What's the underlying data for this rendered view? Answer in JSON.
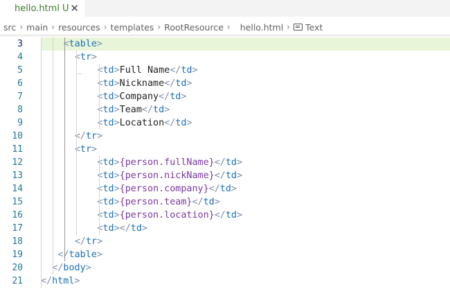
{
  "tab": {
    "filename": "hello.html",
    "status": "U",
    "close_symbol": "✕"
  },
  "breadcrumb": {
    "items": [
      "src",
      "main",
      "resources",
      "templates",
      "RootResource",
      "hello.html"
    ],
    "symbol": "Text",
    "separator": "›"
  },
  "editor": {
    "active_line": 3,
    "colors": {
      "tag": "#1a6fb5",
      "bracket": "#7a8ea8",
      "text": "#222222",
      "expression": "#7b3a9e",
      "line_number": "#237893",
      "highlight": "#e8f5d8"
    },
    "lines": [
      {
        "num": "3",
        "indent": 4,
        "tokens": [
          [
            "br",
            "<"
          ],
          [
            "tg",
            "table"
          ],
          [
            "br",
            ">"
          ]
        ]
      },
      {
        "num": "4",
        "indent": 6,
        "tokens": [
          [
            "br",
            "<"
          ],
          [
            "tg",
            "tr"
          ],
          [
            "br",
            ">"
          ]
        ]
      },
      {
        "num": "5",
        "indent": 10,
        "tokens": [
          [
            "br",
            "<"
          ],
          [
            "tg",
            "td"
          ],
          [
            "br",
            ">"
          ],
          [
            "tx",
            "Full Name"
          ],
          [
            "br",
            "</"
          ],
          [
            "tg",
            "td"
          ],
          [
            "br",
            ">"
          ]
        ]
      },
      {
        "num": "6",
        "indent": 10,
        "tokens": [
          [
            "br",
            "<"
          ],
          [
            "tg",
            "td"
          ],
          [
            "br",
            ">"
          ],
          [
            "tx",
            "Nickname"
          ],
          [
            "br",
            "</"
          ],
          [
            "tg",
            "td"
          ],
          [
            "br",
            ">"
          ]
        ]
      },
      {
        "num": "7",
        "indent": 10,
        "tokens": [
          [
            "br",
            "<"
          ],
          [
            "tg",
            "td"
          ],
          [
            "br",
            ">"
          ],
          [
            "tx",
            "Company"
          ],
          [
            "br",
            "</"
          ],
          [
            "tg",
            "td"
          ],
          [
            "br",
            ">"
          ]
        ]
      },
      {
        "num": "8",
        "indent": 10,
        "tokens": [
          [
            "br",
            "<"
          ],
          [
            "tg",
            "td"
          ],
          [
            "br",
            ">"
          ],
          [
            "tx",
            "Team"
          ],
          [
            "br",
            "</"
          ],
          [
            "tg",
            "td"
          ],
          [
            "br",
            ">"
          ]
        ]
      },
      {
        "num": "9",
        "indent": 10,
        "tokens": [
          [
            "br",
            "<"
          ],
          [
            "tg",
            "td"
          ],
          [
            "br",
            ">"
          ],
          [
            "tx",
            "Location"
          ],
          [
            "br",
            "</"
          ],
          [
            "tg",
            "td"
          ],
          [
            "br",
            ">"
          ]
        ]
      },
      {
        "num": "10",
        "indent": 6,
        "tokens": [
          [
            "br",
            "</"
          ],
          [
            "tg",
            "tr"
          ],
          [
            "br",
            ">"
          ]
        ]
      },
      {
        "num": "11",
        "indent": 6,
        "tokens": [
          [
            "br",
            "<"
          ],
          [
            "tg",
            "tr"
          ],
          [
            "br",
            ">"
          ]
        ]
      },
      {
        "num": "12",
        "indent": 10,
        "tokens": [
          [
            "br",
            "<"
          ],
          [
            "tg",
            "td"
          ],
          [
            "br",
            ">"
          ],
          [
            "ex",
            "{person.fullName}"
          ],
          [
            "br",
            "</"
          ],
          [
            "tg",
            "td"
          ],
          [
            "br",
            ">"
          ]
        ]
      },
      {
        "num": "13",
        "indent": 10,
        "tokens": [
          [
            "br",
            "<"
          ],
          [
            "tg",
            "td"
          ],
          [
            "br",
            ">"
          ],
          [
            "ex",
            "{person.nickName}"
          ],
          [
            "br",
            "</"
          ],
          [
            "tg",
            "td"
          ],
          [
            "br",
            ">"
          ]
        ]
      },
      {
        "num": "14",
        "indent": 10,
        "tokens": [
          [
            "br",
            "<"
          ],
          [
            "tg",
            "td"
          ],
          [
            "br",
            ">"
          ],
          [
            "ex",
            "{person.company}"
          ],
          [
            "br",
            "</"
          ],
          [
            "tg",
            "td"
          ],
          [
            "br",
            ">"
          ]
        ]
      },
      {
        "num": "15",
        "indent": 10,
        "tokens": [
          [
            "br",
            "<"
          ],
          [
            "tg",
            "td"
          ],
          [
            "br",
            ">"
          ],
          [
            "ex",
            "{person.team}"
          ],
          [
            "br",
            "</"
          ],
          [
            "tg",
            "td"
          ],
          [
            "br",
            ">"
          ]
        ]
      },
      {
        "num": "16",
        "indent": 10,
        "tokens": [
          [
            "br",
            "<"
          ],
          [
            "tg",
            "td"
          ],
          [
            "br",
            ">"
          ],
          [
            "ex",
            "{person.location}"
          ],
          [
            "br",
            "</"
          ],
          [
            "tg",
            "td"
          ],
          [
            "br",
            ">"
          ]
        ]
      },
      {
        "num": "17",
        "indent": 10,
        "tokens": [
          [
            "br",
            "<"
          ],
          [
            "tg",
            "td"
          ],
          [
            "br",
            "></"
          ],
          [
            "tg",
            "td"
          ],
          [
            "br",
            ">"
          ]
        ]
      },
      {
        "num": "18",
        "indent": 6,
        "tokens": [
          [
            "br",
            "</"
          ],
          [
            "tg",
            "tr"
          ],
          [
            "br",
            ">"
          ]
        ]
      },
      {
        "num": "19",
        "indent": 3,
        "tokens": [
          [
            "br",
            "</"
          ],
          [
            "tg",
            "table"
          ],
          [
            "br",
            ">"
          ]
        ]
      },
      {
        "num": "20",
        "indent": 2,
        "tokens": [
          [
            "br",
            "</"
          ],
          [
            "tg",
            "body"
          ],
          [
            "br",
            ">"
          ]
        ]
      },
      {
        "num": "21",
        "indent": 0,
        "tokens": [
          [
            "br",
            "</"
          ],
          [
            "tg",
            "html"
          ],
          [
            "br",
            ">"
          ]
        ]
      }
    ]
  }
}
